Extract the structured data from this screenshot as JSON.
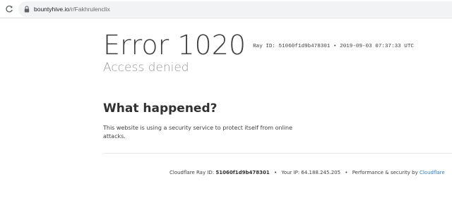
{
  "browser": {
    "url_host": "bountyhive.io",
    "url_path": "/r/Fakhrulenclix"
  },
  "error": {
    "title": "Error 1020",
    "ray_line": "Ray ID: 51060f1d9b478301 • 2019-09-03 07:37:33 UTC",
    "subtitle": "Access denied"
  },
  "what_happened": {
    "heading": "What happened?",
    "body": "This website is using a security service to protect itself from online attacks."
  },
  "footer": {
    "ray_label": "Cloudflare Ray ID:",
    "ray_id": "51060f1d9b478301",
    "separator": "•",
    "ip_text": "Your IP: 64.188.245.205",
    "perf_text": "Performance & security by",
    "cloudflare_link": "Cloudflare"
  },
  "colors": {
    "link": "#2f7bbf",
    "subtitle": "#999999",
    "text": "#404040"
  },
  "icons": [
    "reload-icon",
    "lock-icon"
  ]
}
